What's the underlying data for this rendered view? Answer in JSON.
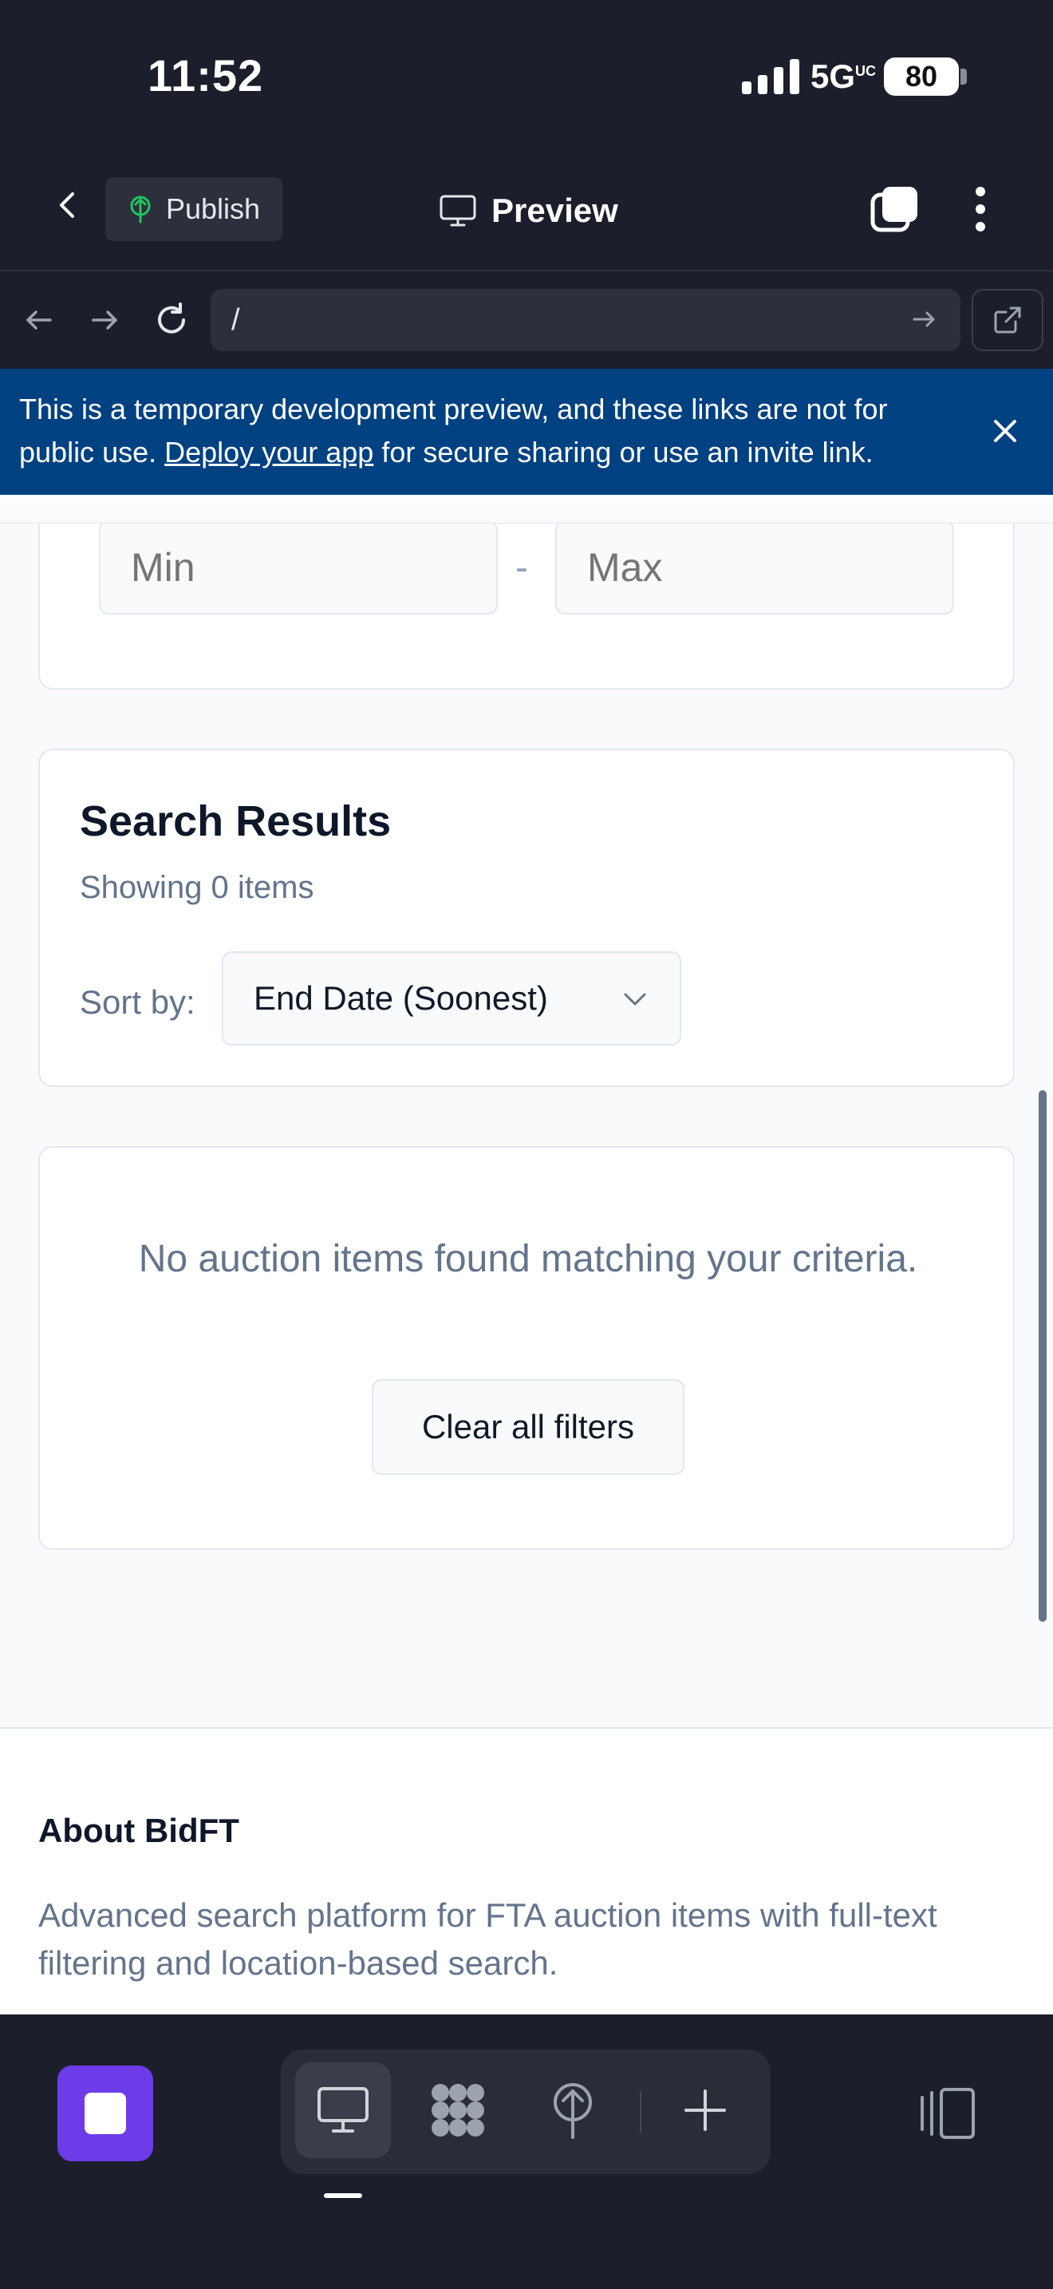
{
  "status_bar": {
    "time": "11:52",
    "network": "5G",
    "network_suffix": "UC",
    "battery": "80"
  },
  "header": {
    "publish_label": "Publish",
    "preview_label": "Preview",
    "icons": [
      "chevron-left-icon",
      "publish-icon",
      "monitor-icon",
      "tabs-icon",
      "more-vertical-icon"
    ]
  },
  "browser": {
    "url": "/"
  },
  "banner": {
    "text_before": "This is a temporary development preview, and these links are not for public use.",
    "link_text": "Deploy your app",
    "text_after": "for secure sharing or use an invite link."
  },
  "filters": {
    "min_placeholder": "Min",
    "max_placeholder": "Max",
    "separator": "-"
  },
  "results": {
    "title": "Search Results",
    "count_text": "Showing 0 items",
    "sort_label": "Sort by:",
    "sort_value": "End Date (Soonest)"
  },
  "empty_state": {
    "message": "No auction items found matching your criteria.",
    "clear_button": "Clear all filters"
  },
  "footer": {
    "title": "About BidFT",
    "text": "Advanced search platform for FTA auction items with full-text filtering and location-based search."
  },
  "colors": {
    "app_bg": "#1c1f2b",
    "banner_bg": "#004182",
    "accent": "#6d3be8",
    "page_bg": "#f8fafc"
  }
}
